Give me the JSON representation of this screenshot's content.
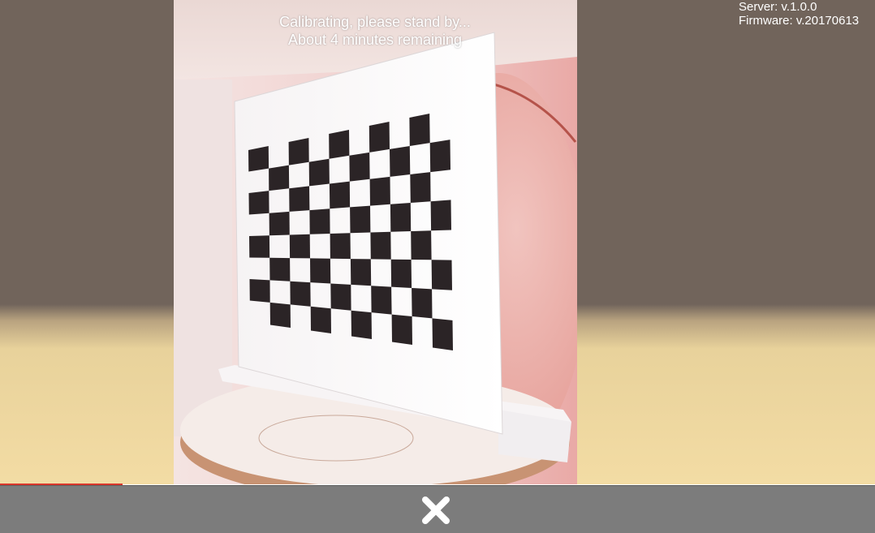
{
  "status": {
    "line1": "Calibrating, please stand by...",
    "line2": "About 4 minutes remaining"
  },
  "version": {
    "server": "Server: v.1.0.0",
    "firmware": "Firmware: v.20170613"
  },
  "progress": {
    "fraction": 0.14,
    "color": "#d9362b"
  },
  "colors": {
    "backdrop_top": "#71645b",
    "backdrop_bottom": "#f3dca4",
    "bottom_bar": "#7c7c7c"
  },
  "icons": {
    "close": "close-icon"
  }
}
